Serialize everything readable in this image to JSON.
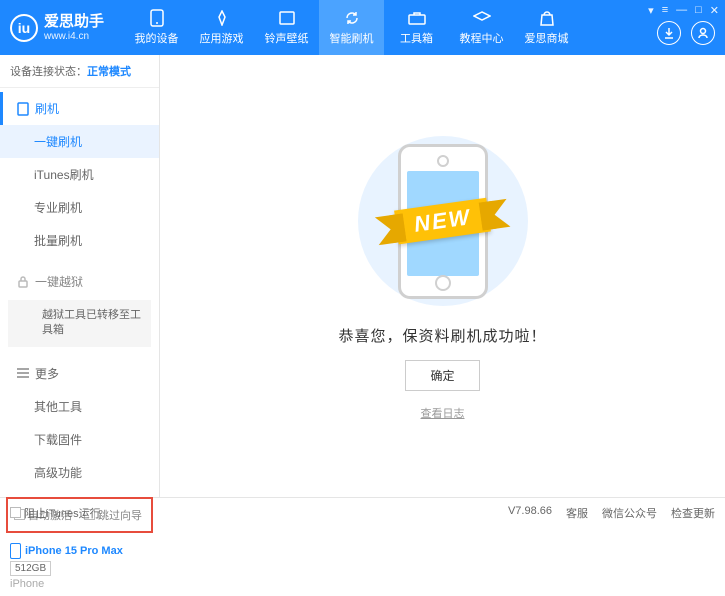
{
  "app": {
    "title": "爱思助手",
    "url": "www.i4.cn"
  },
  "nav": [
    {
      "label": "我的设备"
    },
    {
      "label": "应用游戏"
    },
    {
      "label": "铃声壁纸"
    },
    {
      "label": "智能刷机",
      "active": true
    },
    {
      "label": "工具箱"
    },
    {
      "label": "教程中心"
    },
    {
      "label": "爱思商城"
    }
  ],
  "status": {
    "label": "设备连接状态：",
    "value": "正常模式"
  },
  "sidebar": {
    "flash": {
      "head": "刷机",
      "items": [
        "一键刷机",
        "iTunes刷机",
        "专业刷机",
        "批量刷机"
      ]
    },
    "jailbreak": {
      "head": "一键越狱",
      "note": "越狱工具已转移至工具箱"
    },
    "more": {
      "head": "更多",
      "items": [
        "其他工具",
        "下载固件",
        "高级功能"
      ]
    }
  },
  "checkboxes": {
    "auto_activate": "自动激活",
    "skip_guide": "跳过向导"
  },
  "device": {
    "name": "iPhone 15 Pro Max",
    "storage": "512GB",
    "type": "iPhone"
  },
  "main": {
    "ribbon": "NEW",
    "success": "恭喜您，保资料刷机成功啦！",
    "confirm": "确定",
    "log_link": "查看日志"
  },
  "footer": {
    "block_itunes": "阻止iTunes运行",
    "version": "V7.98.66",
    "links": [
      "客服",
      "微信公众号",
      "检查更新"
    ]
  }
}
